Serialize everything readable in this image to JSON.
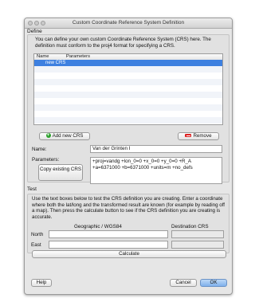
{
  "window": {
    "title": "Custom Coordinate Reference System Definition"
  },
  "define": {
    "section_label": "Define",
    "description": "You can define your own custom Coordinate Reference System (CRS) here. The definition must conform to the proj4 format for specifying a CRS.",
    "table": {
      "columns": [
        "Name",
        "Parameters"
      ],
      "rows": [
        {
          "name": "new CRS",
          "parameters": ""
        }
      ]
    },
    "add_button": "Add new CRS",
    "remove_button": "Remove",
    "name_label": "Name:",
    "name_value": "Van der Grinten I",
    "parameters_label": "Parameters:",
    "copy_button": "Copy existing CRS",
    "parameters_value": "+proj=vandg +lon_0=0 +x_0=0 +y_0=0 +R_A +a=6371000 +b=6371000 +units=m +no_defs"
  },
  "test": {
    "section_label": "Test",
    "description": "Use the text boxes below to test the CRS definition you are creating. Enter a coordinate where both the lat/long and the transformed result are known (for example by reading off a map). Then press the calculate button to see if the CRS definition you are creating is accurate.",
    "geo_header": "Geographic / WGS84",
    "dest_header": "Destination CRS",
    "north_label": "North",
    "east_label": "East",
    "calculate_button": "Calculate"
  },
  "footer": {
    "help": "Help",
    "cancel": "Cancel",
    "ok": "OK"
  }
}
